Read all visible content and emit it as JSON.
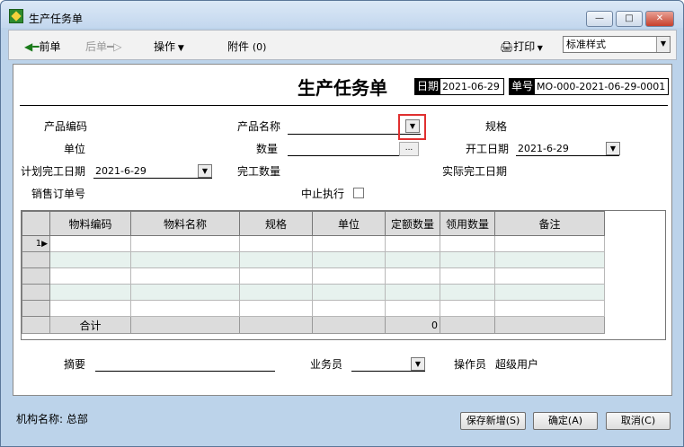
{
  "window": {
    "title": "生产任务单"
  },
  "toolbar": {
    "prev": "前单",
    "next": "后单",
    "operate": "操作",
    "attach": "附件",
    "attach_count": "(0)",
    "print": "打印",
    "style_value": "标准样式"
  },
  "header": {
    "title": "生产任务单",
    "date_label": "日期",
    "date_value": "2021-06-29",
    "no_label": "单号",
    "no_value": "MO-000-2021-06-29-0001"
  },
  "fields": {
    "product_code": {
      "label": "产品编码",
      "value": ""
    },
    "product_name": {
      "label": "产品名称",
      "value": ""
    },
    "spec": {
      "label": "规格",
      "value": ""
    },
    "unit": {
      "label": "单位",
      "value": ""
    },
    "quantity": {
      "label": "数量",
      "value": "",
      "ellipsis": "..."
    },
    "start_date": {
      "label": "开工日期",
      "value": "2021-6-29"
    },
    "plan_finish_date": {
      "label": "计划完工日期",
      "value": "2021-6-29"
    },
    "finished_qty": {
      "label": "完工数量",
      "value": ""
    },
    "actual_finish_date": {
      "label": "实际完工日期",
      "value": ""
    },
    "sales_order_no": {
      "label": "销售订单号",
      "value": ""
    },
    "stop_exec": {
      "label": "中止执行",
      "checked": false
    }
  },
  "grid": {
    "columns": [
      "物料编码",
      "物料名称",
      "规格",
      "单位",
      "定额数量",
      "领用数量",
      "备注"
    ],
    "rows": [
      {
        "num": "1",
        "cells": [
          "",
          "",
          "",
          "",
          "",
          "",
          ""
        ]
      },
      {
        "num": "",
        "cells": [
          "",
          "",
          "",
          "",
          "",
          "",
          ""
        ]
      },
      {
        "num": "",
        "cells": [
          "",
          "",
          "",
          "",
          "",
          "",
          ""
        ]
      },
      {
        "num": "",
        "cells": [
          "",
          "",
          "",
          "",
          "",
          "",
          ""
        ]
      },
      {
        "num": "",
        "cells": [
          "",
          "",
          "",
          "",
          "",
          "",
          ""
        ]
      }
    ],
    "total_label": "合计",
    "total_quota": "0"
  },
  "footer": {
    "summary_label": "摘要",
    "summary_value": "",
    "salesman_label": "业务员",
    "salesman_value": "",
    "operator_label": "操作员",
    "operator_value": "超级用户"
  },
  "status": {
    "org_label": "机构名称:",
    "org_value": "总部"
  },
  "buttons": {
    "save_new": "保存新增(S)",
    "ok": "确定(A)",
    "cancel": "取消(C)"
  },
  "colors": {
    "highlight": "#e03030",
    "grid_alt_row": "#e7f2ee"
  }
}
